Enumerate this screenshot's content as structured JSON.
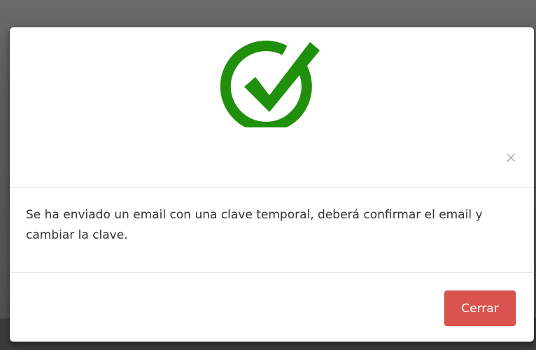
{
  "modal": {
    "icon": "check-circle-icon",
    "icon_color": "#1f8f0c",
    "close_symbol": "×",
    "message": "Se ha enviado un email con una clave temporal, deberá confirmar el email y cambiar la clave.",
    "close_button_label": "Cerrar",
    "close_button_color": "#d9534f"
  }
}
